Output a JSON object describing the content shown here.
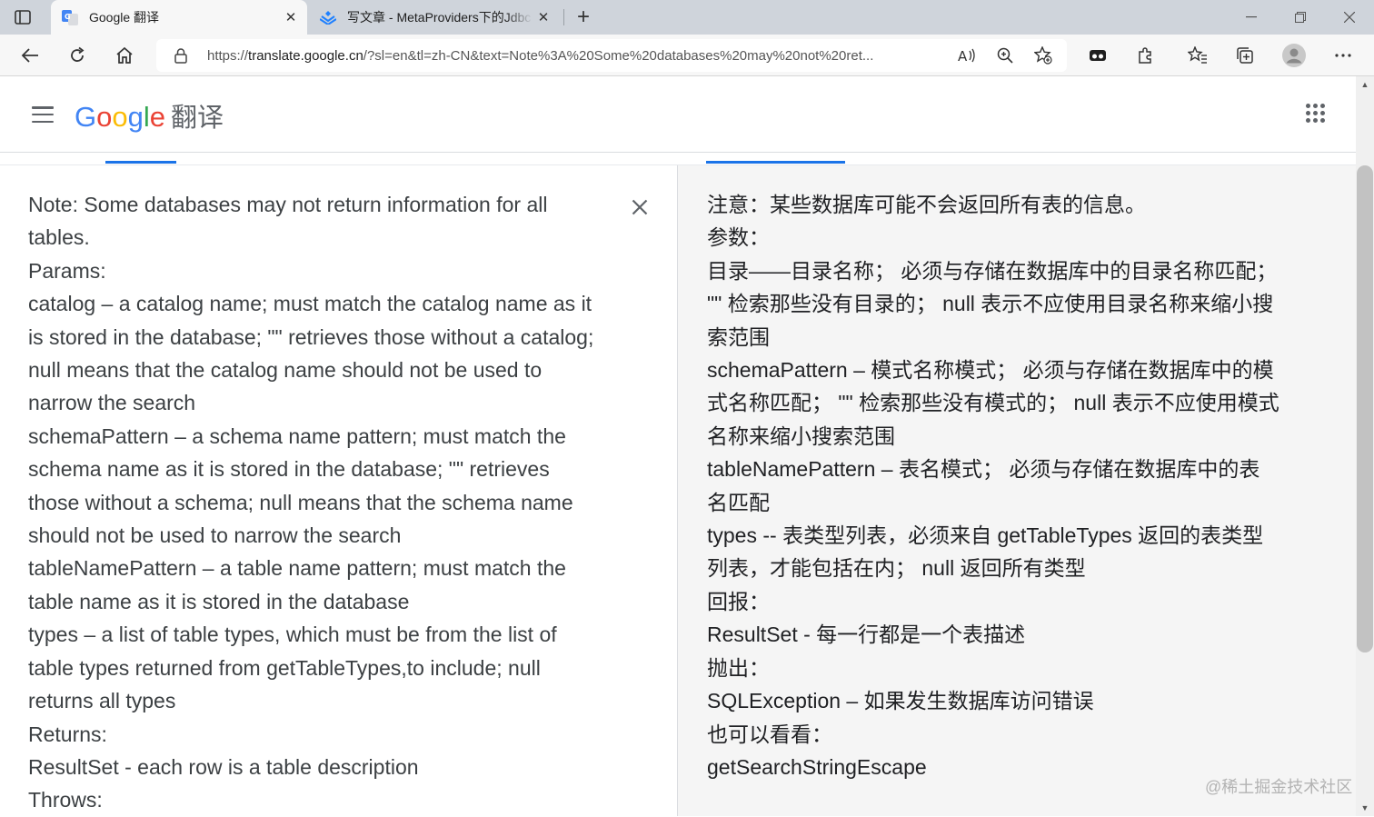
{
  "browser": {
    "tabs": [
      {
        "title": "Google 翻译",
        "active": true,
        "icon": "google-translate-icon"
      },
      {
        "title": "写文章 - MetaProviders下的Jdbc",
        "active": false,
        "icon": "juejin-icon"
      }
    ],
    "address_bar": {
      "url_scheme": "https://",
      "url_host": "translate.google.cn",
      "url_rest": "/?sl=en&tl=zh-CN&text=Note%3A%20Some%20databases%20may%20not%20ret..."
    }
  },
  "header": {
    "logo_letters": [
      "G",
      "o",
      "o",
      "g",
      "l",
      "e"
    ],
    "product": "翻译"
  },
  "source": {
    "lines": [
      "Note: Some databases may not return information for all",
      "tables.",
      "Params:",
      "catalog – a catalog name; must match the catalog name as it",
      "is stored in the database; \"\" retrieves those without a catalog;",
      "null means that the catalog name should not be used to",
      "narrow the search",
      "schemaPattern – a schema name pattern; must match the",
      "schema name as it is stored in the database; \"\" retrieves",
      "those without a schema; null means that the schema name",
      "should not be used to narrow the search",
      "tableNamePattern – a table name pattern; must match the",
      "table name as it is stored in the database",
      "types – a list of table types, which must be from the list of",
      "table types returned from getTableTypes,to include; null",
      "returns all types",
      "Returns:",
      "ResultSet - each row is a table description",
      "Throws:"
    ]
  },
  "target": {
    "lines": [
      "注意：某些数据库可能不会返回所有表的信息。",
      "参数：",
      "目录——目录名称； 必须与存储在数据库中的目录名称匹配；",
      "\"\" 检索那些没有目录的； null 表示不应使用目录名称来缩小搜",
      "索范围",
      "schemaPattern – 模式名称模式； 必须与存储在数据库中的模",
      "式名称匹配； \"\" 检索那些没有模式的； null 表示不应使用模式",
      "名称来缩小搜索范围",
      "tableNamePattern – 表名模式； 必须与存储在数据库中的表",
      "名匹配",
      "types -- 表类型列表，必须来自 getTableTypes 返回的表类型",
      "列表，才能包括在内； null 返回所有类型",
      "回报：",
      "ResultSet - 每一行都是一个表描述",
      "抛出：",
      "SQLException – 如果发生数据库访问错误",
      "也可以看看：",
      "getSearchStringEscape"
    ]
  },
  "watermark": "@稀土掘金技术社区",
  "colors": {
    "accent": "#1a73e8",
    "google_blue": "#4285f4",
    "google_red": "#ea4335",
    "google_yellow": "#fbbc05",
    "google_green": "#34a853"
  }
}
